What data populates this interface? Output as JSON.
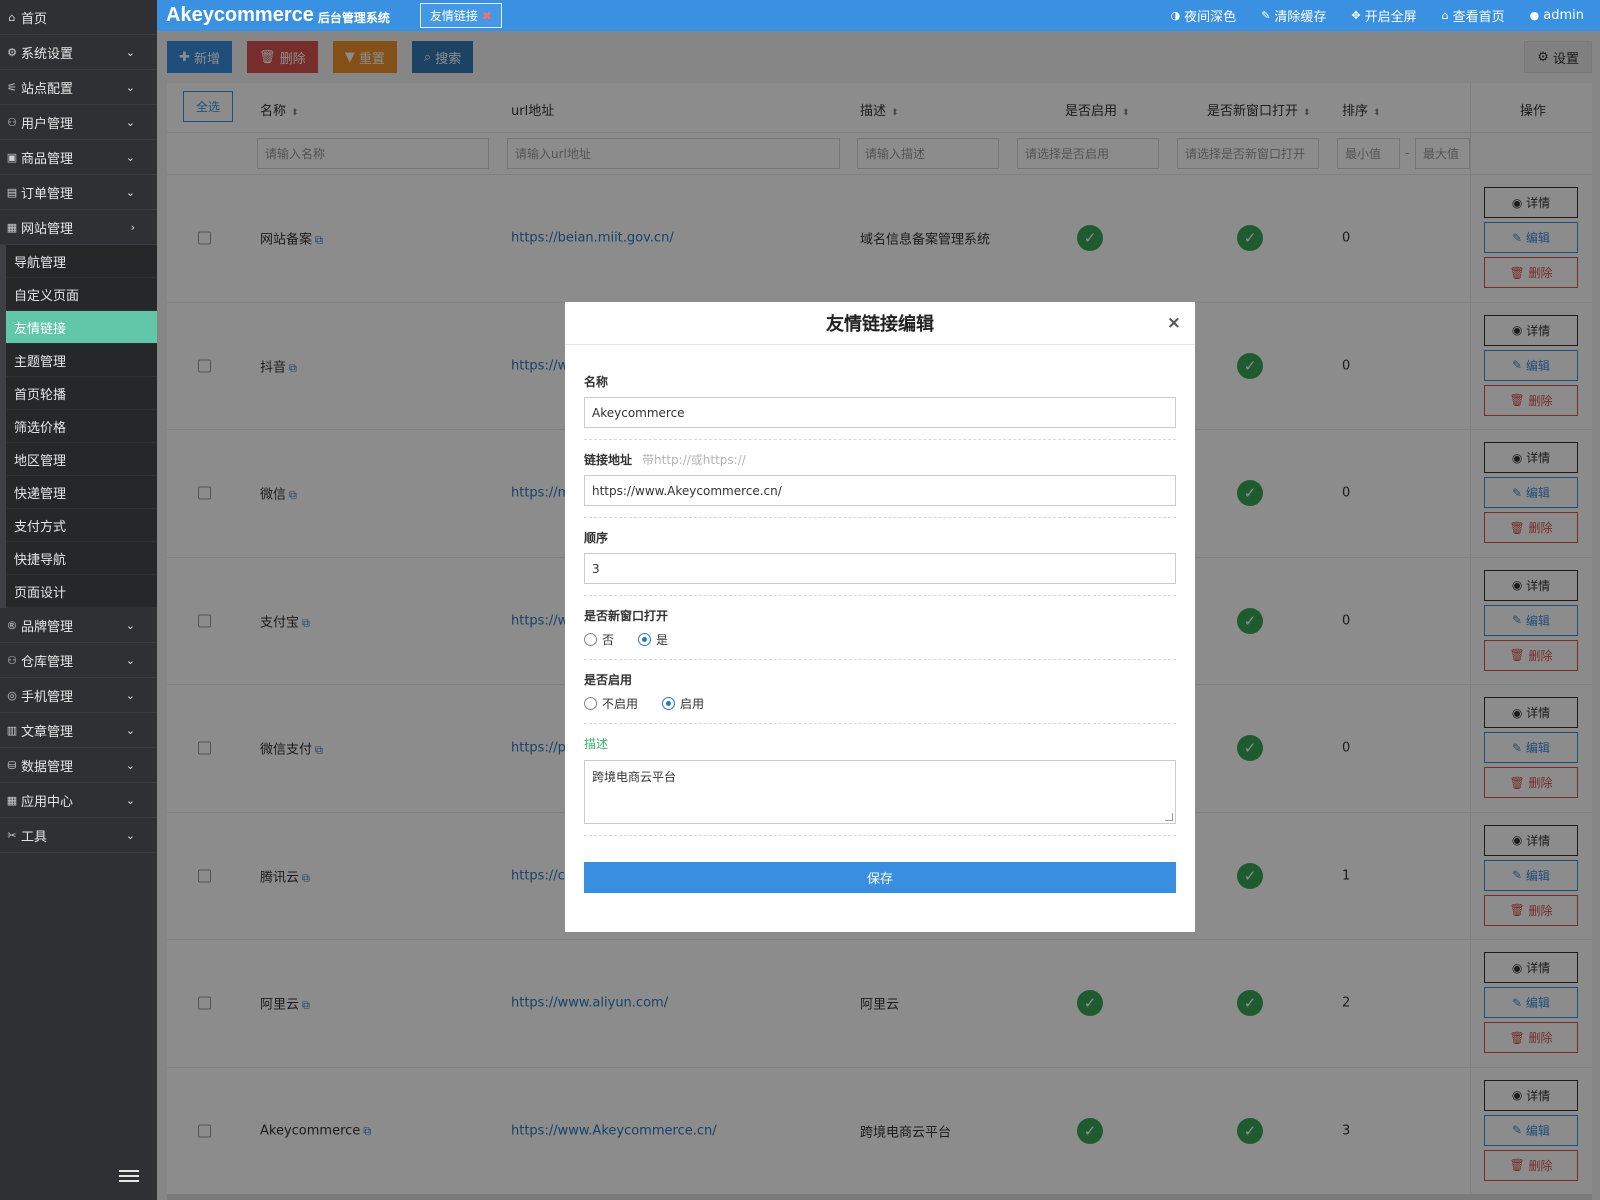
{
  "sidebar": {
    "home": "首页",
    "groups_before": [
      {
        "icon": "⚙",
        "label": "系统设置"
      },
      {
        "icon": "⚟",
        "label": "站点配置"
      },
      {
        "icon": "⚇",
        "label": "用户管理"
      },
      {
        "icon": "▣",
        "label": "商品管理"
      },
      {
        "icon": "▤",
        "label": "订单管理"
      },
      {
        "icon": "▦",
        "label": "网站管理"
      }
    ],
    "sub_items": [
      "导航管理",
      "自定义页面",
      "友情链接",
      "主题管理",
      "首页轮播",
      "筛选价格",
      "地区管理",
      "快递管理",
      "支付方式",
      "快捷导航",
      "页面设计"
    ],
    "groups_after": [
      {
        "icon": "®",
        "label": "品牌管理"
      },
      {
        "icon": "⚇",
        "label": "仓库管理"
      },
      {
        "icon": "◎",
        "label": "手机管理"
      },
      {
        "icon": "▥",
        "label": "文章管理"
      },
      {
        "icon": "⛁",
        "label": "数据管理"
      },
      {
        "icon": "▦",
        "label": "应用中心"
      },
      {
        "icon": "✂",
        "label": "工具"
      }
    ]
  },
  "topbar": {
    "brand": "Akeycommerce",
    "brand_sub": "后台管理系统",
    "active_tab": "友情链接",
    "night_mode": "夜间深色",
    "clear_cache": "清除缓存",
    "fullscreen": "开启全屏",
    "view_home": "查看首页",
    "user": "admin"
  },
  "toolbar": {
    "add": "新增",
    "delete": "删除",
    "reset": "重置",
    "search": "搜索",
    "settings": "设置"
  },
  "table": {
    "select_all": "全选",
    "headers": {
      "name": "名称",
      "url": "url地址",
      "desc": "描述",
      "enabled": "是否启用",
      "new_window": "是否新窗口打开",
      "sort": "排序",
      "actions": "操作"
    },
    "filters": {
      "name": "请输入名称",
      "url": "请输入url地址",
      "desc": "请输入描述",
      "enabled": "请选择是否启用",
      "new_window": "请选择是否新窗口打开",
      "min": "最小值",
      "range_sep": "-",
      "max": "最大值"
    },
    "rows": [
      {
        "name": "网站备案",
        "url": "https://beian.miit.gov.cn/",
        "desc": "域名信息备案管理系统",
        "sort": "0"
      },
      {
        "name": "抖音",
        "url": "https://w",
        "desc": "",
        "sort": "0"
      },
      {
        "name": "微信",
        "url": "https://m",
        "desc": "",
        "sort": "0"
      },
      {
        "name": "支付宝",
        "url": "https://w",
        "desc": "",
        "sort": "0"
      },
      {
        "name": "微信支付",
        "url": "https://pa",
        "desc": "",
        "sort": "0"
      },
      {
        "name": "腾讯云",
        "url": "https://cl",
        "desc": "",
        "sort": "1"
      },
      {
        "name": "阿里云",
        "url": "https://www.aliyun.com/",
        "desc": "阿里云",
        "sort": "2"
      },
      {
        "name": "Akeycommerce",
        "url": "https://www.Akeycommerce.cn/",
        "desc": "跨境电商云平台",
        "sort": "3"
      }
    ],
    "actions": {
      "view": "详情",
      "edit": "编辑",
      "delete": "删除"
    }
  },
  "modal": {
    "title": "友情链接编辑",
    "close": "×",
    "name_label": "名称",
    "name_value": "Akeycommerce",
    "url_label": "链接地址",
    "url_hint": "带http://或https://",
    "url_value": "https://www.Akeycommerce.cn/",
    "order_label": "顺序",
    "order_value": "3",
    "new_window_label": "是否新窗口打开",
    "new_window_no": "否",
    "new_window_yes": "是",
    "enabled_label": "是否启用",
    "enabled_no": "不启用",
    "enabled_yes": "启用",
    "desc_label": "描述",
    "desc_value": "跨境电商云平台",
    "save": "保存"
  },
  "colors": {
    "topbar": "#3a91e2",
    "sidebar": "#2f3034",
    "active_menu": "#61c7a8",
    "success": "#38a856"
  }
}
